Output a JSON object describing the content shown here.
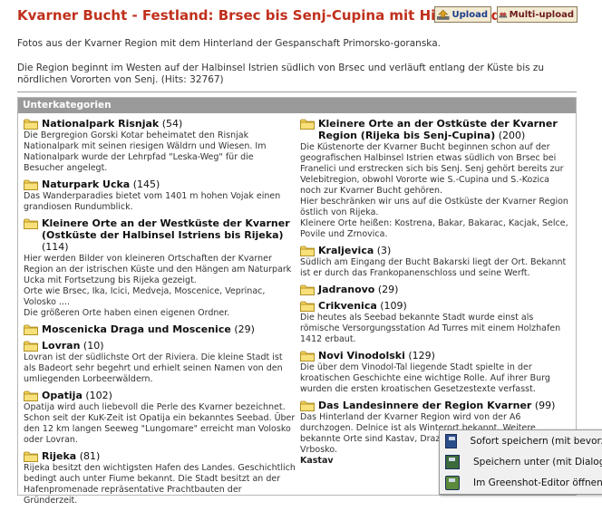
{
  "title": "Kvarner Bucht - Festland: Brsec bis Senj-Cupina mit Hinterland",
  "toolbar": {
    "upload_label": "Upload",
    "multi_upload_label": "Multi-upload"
  },
  "intro": {
    "line1": "Fotos aus der Kvarner Region mit dem Hinterland der Gespanschaft Primorsko-goranska.",
    "line2": "Die Region beginnt im Westen auf der Halbinsel Istrien südlich von Brsec und verläuft entlang der Küste bis zu nördlichen Vororten von Senj. (Hits: 32767)"
  },
  "subcategories_header": "Unterkategorien",
  "left_categories": [
    {
      "title": "Nationalpark Risnjak",
      "count": "(54)",
      "desc": "Die Bergregion Gorski Kotar beheimatet den Risnjak Nationalpark mit seinen riesigen Wäldrn und Wiesen. Im Nationalpark wurde der Lehrpfad \"Leska-Weg\" für die Besucher angelegt."
    },
    {
      "title": "Naturpark Ucka",
      "count": "(145)",
      "desc": "Das Wanderparadies bietet vom 1401 m hohen Vojak einen grandiosen Rundumblick."
    },
    {
      "title": "Kleinere Orte an der Westküste der Kvarner (Ostküste der Halbinsel Istriens bis Rijeka)",
      "count": "(114)",
      "desc": "Hier werden Bilder von kleineren Ortschaften der Kvarner Region an der istrischen Küste und den Hängen am Naturpark Ucka mit Fortsetzung bis Rijeka gezeigt.\nOrte wie Brsec, Ika, Icici, Medveja, Moscenice, Veprinac, Volosko ....\nDie größeren Orte haben einen eigenen Ordner."
    },
    {
      "title": "Moscenicka Draga und Moscenice",
      "count": "(29)",
      "desc": ""
    },
    {
      "title": "Lovran",
      "count": "(10)",
      "desc": "Lovran ist der südlichste Ort der Riviera. Die kleine Stadt ist als Badeort sehr begehrt und erhielt seinen Namen von den umliegenden Lorbeerwäldern."
    },
    {
      "title": "Opatija",
      "count": "(102)",
      "desc": "Opatija wird auch liebevoll die Perle des Kvarner bezeichnet. Schon seit der KuK-Zeit ist Opatija ein bekanntes Seebad. Über den 12 km langen Seeweg \"Lungomare\" erreicht man Volosko oder Lovran."
    },
    {
      "title": "Rijeka",
      "count": "(81)",
      "desc": "Rijeka besitzt den wichtigsten Hafen des Landes. Geschichtlich bedingt auch unter Fiume bekannt. Die Stadt besitzt an der Hafenpromenade repräsentative Prachtbauten der Gründerzeit."
    }
  ],
  "right_categories": [
    {
      "title": "Kleinere Orte an der Ostküste der Kvarner Region (Rijeka bis Senj-Cupina)",
      "count": "(200)",
      "desc": "Die Küstenorte der Kvarner Bucht beginnen schon auf der geografischen Halbinsel Istrien etwas südlich von Brsec bei Franelici und erstrecken sich bis Senj. Senj gehört bereits zur Velebitregion, obwohl Vororte wie S.-Cupina und S.-Kozica noch zur Kvarner Bucht gehören.\nHier beschränken wir uns auf die Ostküste der Kvarner Region östlich von Rijeka.\nKleinere Orte heißen: Kostrena, Bakar, Bakarac, Kacjak, Selce, Povile und Zrnovica."
    },
    {
      "title": "Kraljevica",
      "count": "(3)",
      "desc": "Südlich am Eingang der Bucht Bakarski liegt der Ort. Bekannt ist er durch das Frankopanenschloss und seine Werft."
    },
    {
      "title": "Jadranovo",
      "count": "(29)",
      "desc": ""
    },
    {
      "title": "Crikvenica",
      "count": "(109)",
      "desc": "Die heutes als Seebad bekannte Stadt wurde einst als römische Versorgungsstation Ad Turres mit einem Holzhafen 1412 erbaut."
    },
    {
      "title": "Novi Vinodolski",
      "count": "(129)",
      "desc": "Die über dem Vinodol-Tal liegende Stadt spielte in der kroatischen Geschichte eine wichtige Rolle. Auf ihrer Burg wurden die ersten kroatischen Gesetzestexte verfasst."
    },
    {
      "title": "Das Landesinnere der Region Kvarner",
      "count": "(99)",
      "desc": "Das Hinterland der Kvarner Region wird von der A6 durchzogen. Delnice ist als Winterort bekannt. Weitere bekannte Orte sind Kastav, Drazice, Cavle, Podhum, Fu\nVrbosko.",
      "extra": "Kastav"
    }
  ],
  "context_menu": {
    "items": [
      {
        "label": "Sofort speichern (mit bevorzu"
      },
      {
        "label": "Speichern unter (mit Dialog)"
      },
      {
        "label": "Im Greenshot-Editor öffnen"
      }
    ]
  }
}
